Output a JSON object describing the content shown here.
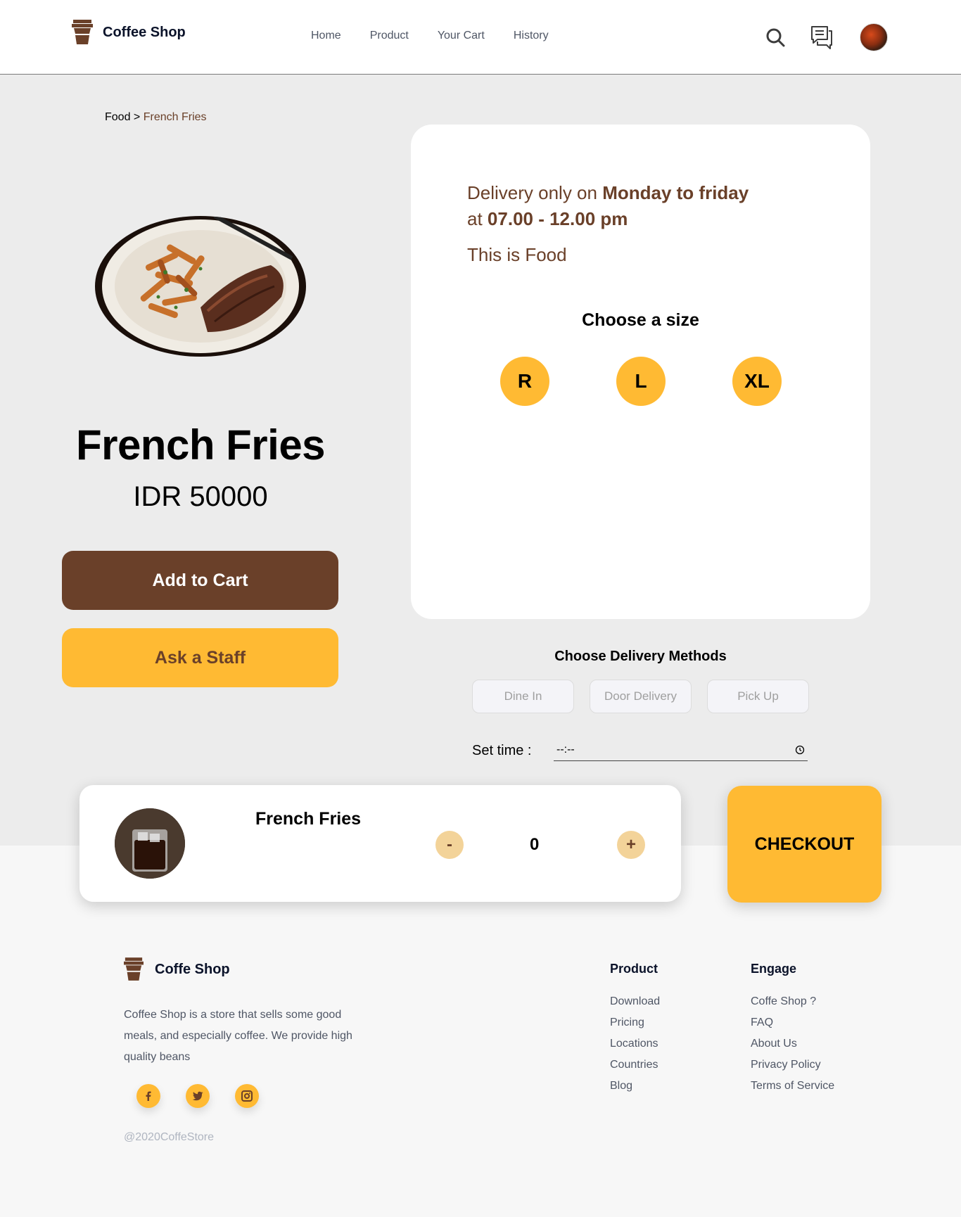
{
  "header": {
    "brand": "Coffee Shop",
    "nav": [
      "Home",
      "Product",
      "Your Cart",
      "History"
    ],
    "icons": [
      "search-icon",
      "chat-icon",
      "avatar"
    ]
  },
  "breadcrumb": {
    "parent": "Food",
    "separator": ">",
    "current": "French Fries"
  },
  "product": {
    "name": "French Fries",
    "price": "IDR 50000",
    "add_to_cart": "Add to Cart",
    "ask_staff": "Ask a Staff"
  },
  "details": {
    "delivery_prefix": "Delivery only on ",
    "delivery_days": "Monday to friday",
    "delivery_at": " at ",
    "delivery_hours": "07.00 - 12.00 pm",
    "description": "This is Food",
    "size_title": "Choose a size",
    "sizes": [
      "R",
      "L",
      "XL"
    ]
  },
  "delivery_methods": {
    "title": "Choose Delivery Methods",
    "options": [
      "Dine In",
      "Door Delivery",
      "Pick Up"
    ],
    "time_label": "Set time :",
    "time_value": "--:--"
  },
  "cart_bar": {
    "item_name": "French Fries",
    "minus": "-",
    "plus": "+",
    "quantity": "0",
    "checkout": "CHECKOUT"
  },
  "footer": {
    "brand": "Coffe Shop",
    "description": "Coffee Shop is a store that sells some good meals, and especially coffee. We provide high quality beans",
    "socials": [
      "facebook-icon",
      "twitter-icon",
      "instagram-icon"
    ],
    "copyright": "@2020CoffeStore",
    "product_col": {
      "title": "Product",
      "links": [
        "Download",
        "Pricing",
        "Locations",
        "Countries",
        "Blog"
      ]
    },
    "engage_col": {
      "title": "Engage",
      "links": [
        "Coffe Shop ?",
        "FAQ",
        "About Us",
        "Privacy Policy",
        "Terms of Service"
      ]
    }
  },
  "colors": {
    "brown": "#6a4029",
    "yellow": "#ffba33",
    "light_yellow": "#f3d399",
    "bg_main": "#ececec",
    "bg_footer": "#f7f7f7"
  }
}
